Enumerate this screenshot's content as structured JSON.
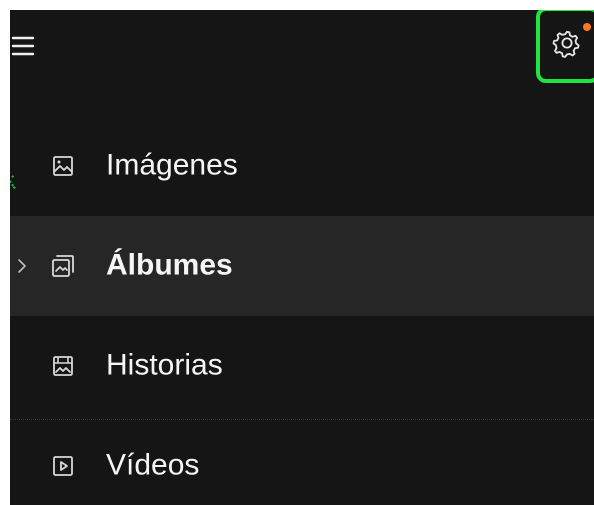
{
  "topbar": {
    "menu_icon": "hamburger-menu-icon",
    "settings_icon": "gear-icon",
    "notification_color": "#ff7a1a",
    "focus_color": "#20e53f"
  },
  "nav": {
    "items": [
      {
        "label": "Imágenes",
        "icon": "image-icon",
        "selected": false
      },
      {
        "label": "Álbumes",
        "icon": "album-icon",
        "selected": true
      },
      {
        "label": "Historias",
        "icon": "stories-icon",
        "selected": false
      },
      {
        "label": "Vídeos",
        "icon": "video-icon",
        "selected": false
      }
    ]
  },
  "colors": {
    "panel_background": "#151515",
    "selected_background": "#262626",
    "text": "#f5f5f5",
    "icon": "#d9d9d9"
  }
}
